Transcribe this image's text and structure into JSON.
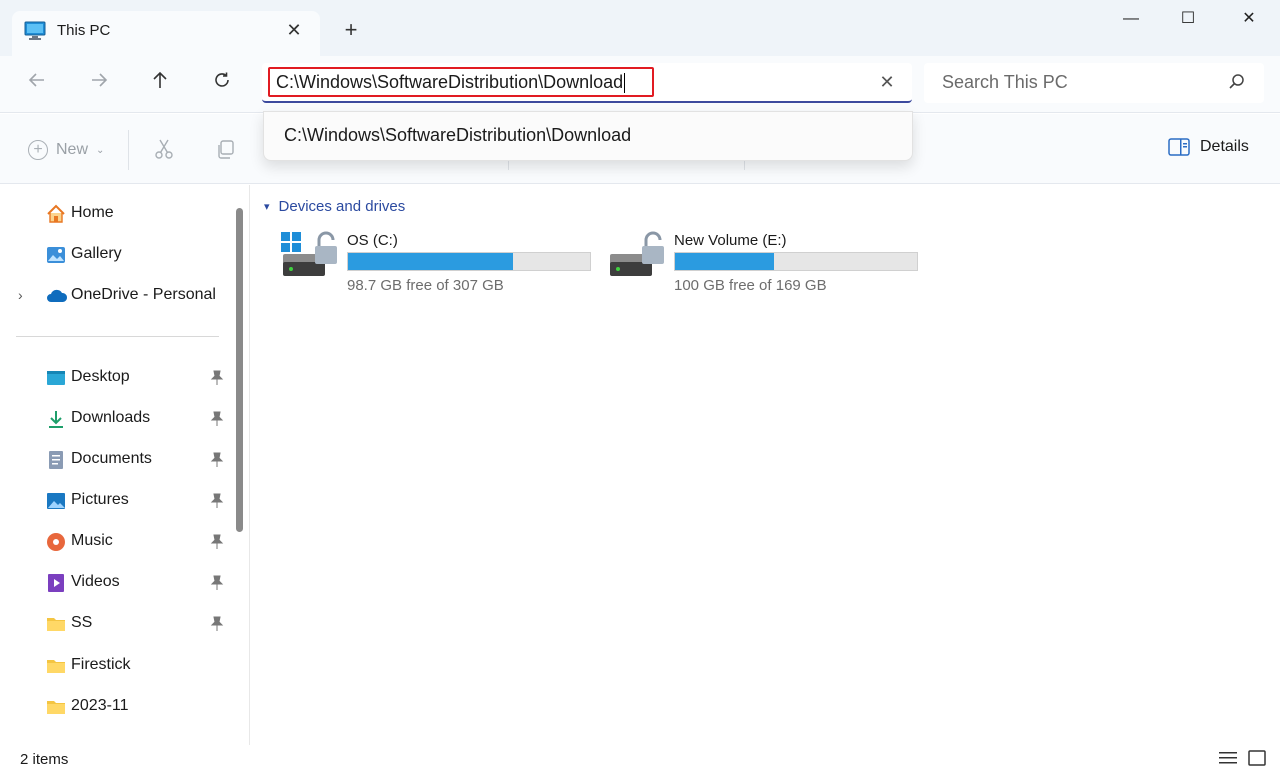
{
  "window": {
    "tab_title": "This PC",
    "new_tab_label": "+",
    "tab_close_label": "✕",
    "minimize_label": "—",
    "maximize_label": "☐",
    "close_label": "✕"
  },
  "navigation": {
    "back_icon": "back-arrow-icon",
    "forward_icon": "forward-arrow-icon",
    "up_icon": "up-arrow-icon",
    "refresh_icon": "refresh-icon",
    "address_value": "C:\\Windows\\SoftwareDistribution\\Download",
    "address_clear_label": "✕",
    "search_placeholder": "Search This PC"
  },
  "address_suggestion": {
    "items": [
      "C:\\Windows\\SoftwareDistribution\\Download"
    ]
  },
  "command_bar": {
    "new_label": "New",
    "details_label": "Details"
  },
  "sidebar": {
    "top_items": [
      {
        "label": "Home",
        "icon": "home-icon"
      },
      {
        "label": "Gallery",
        "icon": "gallery-icon"
      },
      {
        "label": "OneDrive - Personal",
        "icon": "onedrive-cloud-icon"
      }
    ],
    "quick_access": [
      {
        "label": "Desktop",
        "icon": "desktop-folder-icon",
        "pinned": true
      },
      {
        "label": "Downloads",
        "icon": "downloads-icon",
        "pinned": true
      },
      {
        "label": "Documents",
        "icon": "documents-icon",
        "pinned": true
      },
      {
        "label": "Pictures",
        "icon": "pictures-icon",
        "pinned": true
      },
      {
        "label": "Music",
        "icon": "music-icon",
        "pinned": true
      },
      {
        "label": "Videos",
        "icon": "videos-icon",
        "pinned": true
      },
      {
        "label": "SS",
        "icon": "folder-icon",
        "pinned": true
      },
      {
        "label": "Firestick",
        "icon": "folder-icon",
        "pinned": false
      },
      {
        "label": "2023-11",
        "icon": "folder-icon",
        "pinned": false
      }
    ]
  },
  "content": {
    "group_title": "Devices and drives",
    "drives": [
      {
        "name": "OS (C:)",
        "free_text": "98.7 GB free of 307 GB",
        "used_fraction": 0.68,
        "icon": "windows-drive-locked-icon"
      },
      {
        "name": "New Volume (E:)",
        "free_text": "100 GB free of 169 GB",
        "used_fraction": 0.41,
        "icon": "drive-locked-icon"
      }
    ]
  },
  "status_bar": {
    "item_count": "2 items"
  },
  "colors": {
    "accent_blue": "#2b9be0",
    "group_header": "#2b4aa0",
    "highlight_border": "#e11b22"
  }
}
